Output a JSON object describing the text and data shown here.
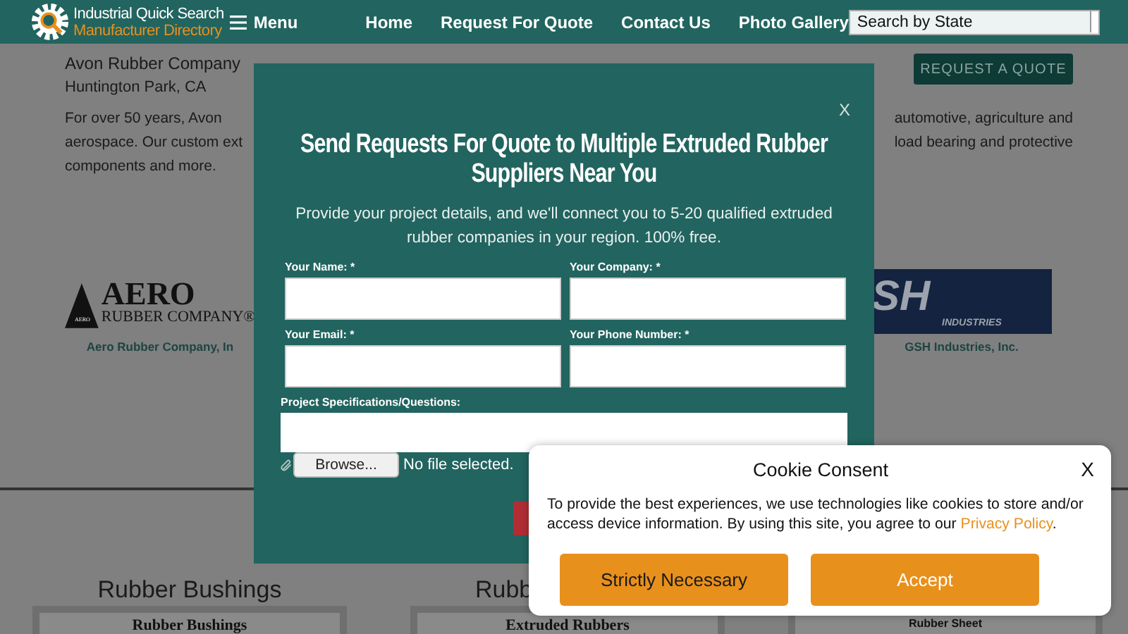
{
  "header": {
    "logo_line1": "Industrial Quick Search",
    "logo_line2": "Manufacturer Directory",
    "menu": "Menu",
    "nav": [
      "Home",
      "Request For Quote",
      "Contact Us",
      "Photo Gallery"
    ],
    "state_select": {
      "value": "Search by State"
    }
  },
  "company": {
    "name": "Avon Rubber Company",
    "location": "Huntington Park, CA",
    "quote_button": "REQUEST A QUOTE",
    "description_lines": [
      {
        "left": "For over 50 years, Avon",
        "right": "automotive, agriculture and"
      },
      {
        "left": "aerospace. Our custom ext",
        "right": "load bearing and protective"
      },
      {
        "left": "components and more."
      }
    ]
  },
  "suppliers": [
    {
      "kind": "aero",
      "logo_title": "AERO",
      "logo_subtitle": "RUBBER COMPANY®",
      "logo_mark": "AERO",
      "name": "Aero Rubber Company, In"
    },
    {
      "kind": "gsh",
      "logo_title": "SH",
      "logo_subtitle": "INDUSTRIES",
      "name": "GSH Industries, Inc."
    }
  ],
  "categories": [
    {
      "heading": "Rubber Bushings",
      "card": "Rubber Bushings"
    },
    {
      "heading": "Rubb",
      "card": "Extruded Rubbers"
    },
    {
      "card": "Rubber Sheet"
    }
  ],
  "quote_modal": {
    "close": "X",
    "title": "Send Requests For Quote to Multiple Extruded Rubber Suppliers Near You",
    "subtitle": "Provide your project details, and we'll connect you to 5-20 qualified extruded rubber companies in your region. 100% free.",
    "fields": [
      {
        "label": "Your Name: *"
      },
      {
        "label": "Your Company: *"
      },
      {
        "label": "Your Email: *"
      },
      {
        "label": "Your Phone Number: *"
      }
    ],
    "specs_label": "Project Specifications/Questions:",
    "browse": "Browse...",
    "file_status": "No file selected."
  },
  "cookie_consent": {
    "title": "Cookie Consent",
    "close": "X",
    "text": "To provide the best experiences, we use technologies like cookies to store and/or access device information. By using this site, you agree to our",
    "link": "Privacy Policy",
    "after_link": ".",
    "buttons": [
      {
        "label": "Strictly Necessary",
        "kind": "secondary"
      },
      {
        "label": "Accept",
        "kind": "primary"
      }
    ]
  }
}
